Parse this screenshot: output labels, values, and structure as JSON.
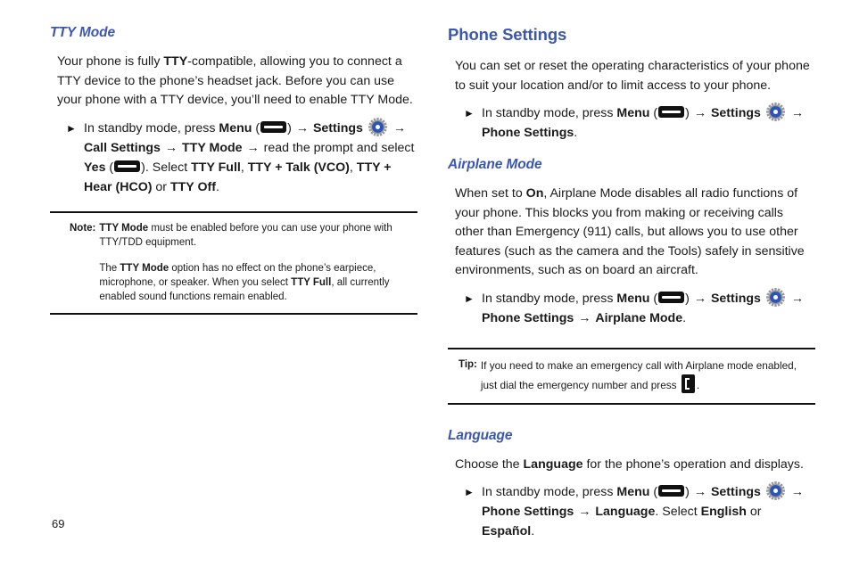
{
  "page": {
    "number": "69"
  },
  "icons": {
    "menu_key": "menu-key-icon",
    "settings_gear": "settings-gear-icon",
    "send_key": "send-key-icon",
    "bullet": "triangle-bullet-icon",
    "arrow": "→"
  },
  "colors": {
    "heading_blue": "#3b57b0",
    "gear_blue": "#2a54b8",
    "gear_gray": "#9a9a9a",
    "rule_black": "#111111",
    "body_text": "#1a1a1a"
  },
  "left_column": {
    "heading": "TTY Mode",
    "intro_paragraph": "Your phone is fully TTY-compatible, allowing you to connect a TTY device to the phone’s headset jack. Before you can use your phone with a TTY device, you’ll need to enable TTY Mode.",
    "intro_bold_terms": [
      "TTY"
    ],
    "bullet": {
      "lead": "In standby mode, press",
      "menu_label": "Menu",
      "settings_label": "Settings",
      "path_1": "Call Settings",
      "path_2": "TTY Mode",
      "mid_text": "read the prompt and select",
      "yes_label": "Yes",
      "select_text": "Select",
      "options": [
        "TTY Full",
        "TTY + Talk (VCO)",
        "TTY + Hear (HCO)",
        "TTY Off"
      ],
      "or_text": "or"
    },
    "note": {
      "label": "Note:",
      "paragraph_1_bold": "TTY Mode",
      "paragraph_1": " must be enabled before you can use your phone with TTY/TDD equipment.",
      "paragraph_2_prefix": "The ",
      "paragraph_2_bold_1": "TTY Mode",
      "paragraph_2_middle": " option has no effect on the phone’s earpiece, microphone, or speaker. When you select ",
      "paragraph_2_bold_2": "TTY Full",
      "paragraph_2_suffix": ", all currently enabled sound functions remain enabled."
    }
  },
  "right_column": {
    "heading": "Phone Settings",
    "intro_paragraph": "You can set or reset the operating characteristics of your phone to suit your location and/or to limit access to your phone.",
    "bullet_main": {
      "lead": "In standby mode, press",
      "menu_label": "Menu",
      "settings_label": "Settings",
      "path_1": "Phone Settings",
      "period": "."
    },
    "airplane": {
      "heading": "Airplane Mode",
      "paragraph_prefix": "When set to ",
      "paragraph_bold": "On",
      "paragraph_suffix": ", Airplane Mode disables all radio functions of your phone. This blocks you from making or receiving calls other than Emergency (911) calls, but allows you to use other features (such as the camera and the Tools) safely in sensitive environments, such as on board an aircraft.",
      "bullet": {
        "lead": "In standby mode, press",
        "menu_label": "Menu",
        "settings_label": "Settings",
        "path_1": "Phone Settings",
        "path_2": "Airplane Mode",
        "period": "."
      },
      "tip": {
        "label": "Tip:",
        "line_1": "If you need to make an emergency call with Airplane mode enabled, just",
        "line_2_prefix": "dial the emergency number and press",
        "line_2_suffix": "."
      }
    },
    "language": {
      "heading": "Language",
      "paragraph_prefix": "Choose the ",
      "paragraph_bold": "Language",
      "paragraph_suffix": " for the phone’s operation and displays.",
      "bullet": {
        "lead": "In standby mode, press",
        "menu_label": "Menu",
        "settings_label": "Settings",
        "path_1": "Phone Settings",
        "path_2": "Language",
        "select_text": ". Select",
        "option_1": "English",
        "or_text": "or",
        "option_2": "Español",
        "period": "."
      }
    }
  }
}
